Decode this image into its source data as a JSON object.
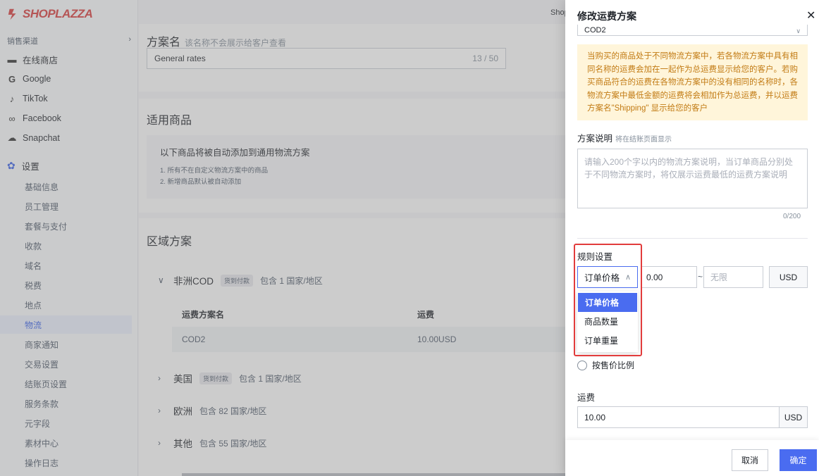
{
  "brand": {
    "name": "SHOPLAZZA",
    "color": "#d63a3a"
  },
  "sidebar": {
    "sales_channels_label": "销售渠道",
    "channels": [
      {
        "label": "在线商店",
        "icon": "store-icon",
        "glyph": "▬"
      },
      {
        "label": "Google",
        "icon": "google-icon",
        "glyph": "G"
      },
      {
        "label": "TikTok",
        "icon": "tiktok-icon",
        "glyph": "♪"
      },
      {
        "label": "Facebook",
        "icon": "facebook-icon",
        "glyph": "∞"
      },
      {
        "label": "Snapchat",
        "icon": "snapchat-icon",
        "glyph": "☁"
      }
    ],
    "settings_label": "设置",
    "settings_items": [
      "基础信息",
      "员工管理",
      "套餐与支付",
      "收款",
      "域名",
      "税费",
      "地点",
      "物流",
      "商家通知",
      "交易设置",
      "结账页设置",
      "服务条款",
      "元字段",
      "素材中心",
      "操作日志"
    ],
    "active_item": "物流"
  },
  "main": {
    "topbar_text": "Shop",
    "plan_name": {
      "title": "方案名",
      "hint": "该名称不会展示给客户查看",
      "value": "General rates",
      "count": "13 / 50"
    },
    "goods": {
      "title": "适用商品",
      "heading": "以下商品将被自动添加到通用物流方案",
      "lines": [
        "1. 所有不在自定义物流方案中的商品",
        "2. 新增商品默认被自动添加"
      ]
    },
    "zones_title": "区域方案",
    "zones": [
      {
        "name": "非洲COD",
        "tag": "货到付款",
        "includes": "包含 1 国家/地区",
        "expanded": true
      },
      {
        "name": "美国",
        "tag": "货到付款",
        "includes": "包含 1 国家/地区",
        "expanded": false
      },
      {
        "name": "欧洲",
        "tag": "",
        "includes": "包含 82 国家/地区",
        "expanded": false
      },
      {
        "name": "其他",
        "tag": "",
        "includes": "包含 55 国家/地区",
        "expanded": false
      }
    ],
    "rate_table": {
      "headers": [
        "运费方案名",
        "运费"
      ],
      "rows": [
        [
          "COD2",
          "10.00USD"
        ]
      ]
    }
  },
  "drawer": {
    "title": "修改运费方案",
    "plan_select_value": "COD2",
    "notice": "当购买的商品处于不同物流方案中，若各物流方案中具有相同名称的运费会加在一起作为总运费显示给您的客户。若购买商品符合的运费在各物流方案中的没有相同的名称时，各物流方案中最低金额的运费将会相加作为总运费，并以运费方案名\"Shipping\" 显示给您的客户",
    "desc_label": "方案说明",
    "desc_hint": "将在结账页面显示",
    "desc_placeholder": "请输入200个字以内的物流方案说明，当订单商品分别处于不同物流方案时，将仅展示运费最低的运费方案说明",
    "desc_count": "0/200",
    "rules_label": "规则设置",
    "condition_value": "订单价格",
    "min_value": "0.00",
    "range_sep": "~",
    "max_placeholder": "无限",
    "currency": "USD",
    "condition_options": [
      "订单价格",
      "商品数量",
      "订单重量"
    ],
    "selected_option": "订单价格",
    "radio_label": "按售价比例",
    "fee_label": "运费",
    "fee_value": "10.00",
    "fee_currency": "USD",
    "cancel_label": "取消",
    "confirm_label": "确定",
    "accent_color": "#4a6cf0",
    "highlight_color": "#e23c3c"
  }
}
